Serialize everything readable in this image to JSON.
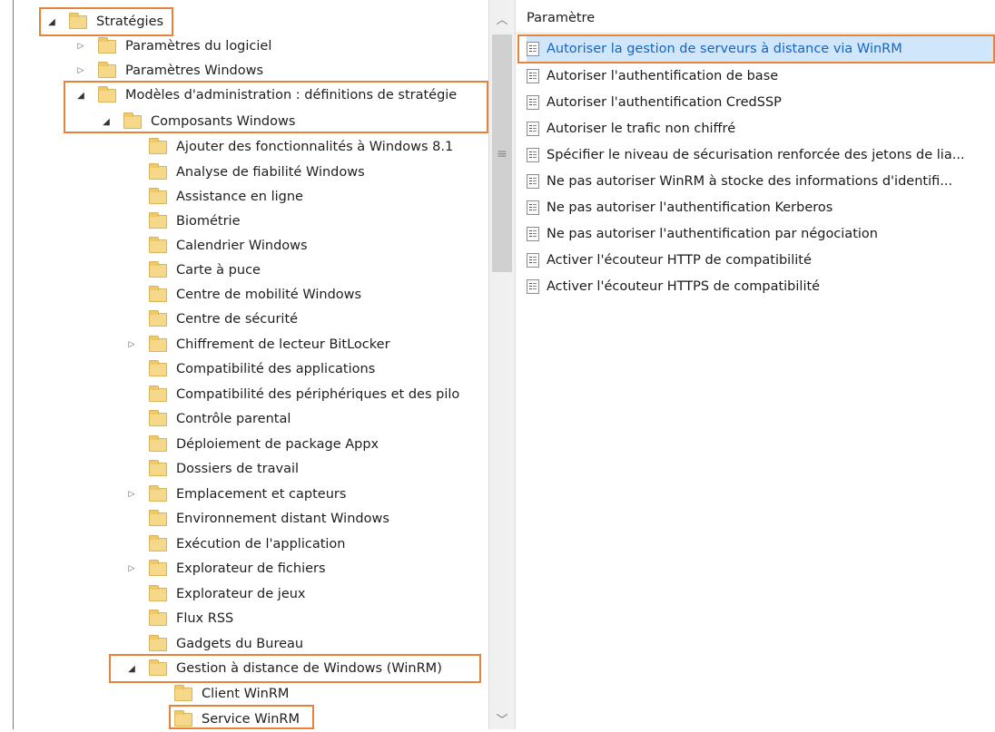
{
  "tree": {
    "root": "Stratégies",
    "software": "Paramètres du logiciel",
    "windows": "Paramètres Windows",
    "admin_templates": "Modèles d'administration : définitions de stratégie",
    "windows_components": "Composants Windows",
    "children": [
      "Ajouter des fonctionnalités à Windows 8.1",
      "Analyse de fiabilité Windows",
      "Assistance en ligne",
      "Biométrie",
      "Calendrier Windows",
      "Carte à puce",
      "Centre de mobilité Windows",
      "Centre de sécurité",
      "Chiffrement de lecteur BitLocker",
      "Compatibilité des applications",
      "Compatibilité des périphériques et des pilo",
      "Contrôle parental",
      "Déploiement de package Appx",
      "Dossiers de travail",
      "Emplacement et capteurs",
      "Environnement distant Windows",
      "Exécution de l'application",
      "Explorateur de fichiers",
      "Explorateur de jeux",
      "Flux RSS",
      "Gadgets du Bureau",
      "Gestion à distance de Windows (WinRM)"
    ],
    "winrm_children": [
      "Client WinRM",
      "Service WinRM"
    ]
  },
  "scrollbar": {
    "up": "︿",
    "down": "﹀",
    "grip": "≡"
  },
  "details": {
    "column_header": "Paramètre",
    "policies": [
      "Autoriser la gestion de serveurs à distance via WinRM",
      "Autoriser l'authentification de base",
      "Autoriser l'authentification CredSSP",
      "Autoriser le trafic non chiffré",
      "Spécifier le niveau de sécurisation renforcée des jetons de lia...",
      "Ne pas autoriser WinRM à stocke des informations d'identifi...",
      "Ne pas autoriser l'authentification Kerberos",
      "Ne pas autoriser l'authentification par négociation",
      "Activer l'écouteur HTTP de compatibilité",
      "Activer l'écouteur HTTPS de compatibilité"
    ]
  },
  "colors": {
    "highlight": "#e8823a",
    "selected_bg": "#cfe6fb",
    "selected_text": "#1565c0",
    "folder": "#f5d88a"
  }
}
